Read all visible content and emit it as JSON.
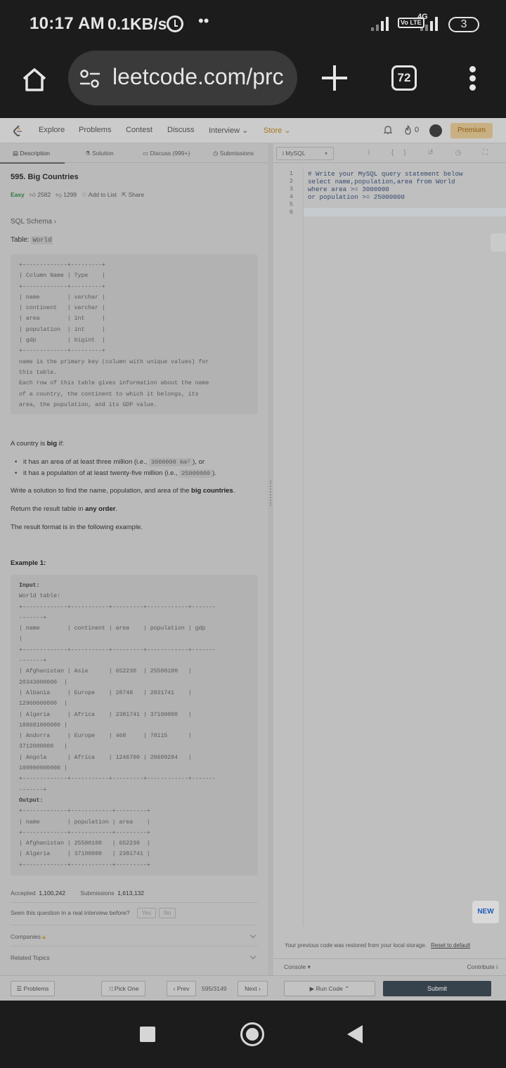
{
  "status": {
    "time": "10:17 AM",
    "speed": "0.1KB/s",
    "dots": "••",
    "volte": "Vo LTE",
    "network": "4G",
    "battery": "3"
  },
  "browser": {
    "url": "leetcode.com/prc",
    "tab_count": "72"
  },
  "nav": {
    "items": [
      "Explore",
      "Problems",
      "Contest",
      "Discuss",
      "Interview",
      "Store"
    ],
    "streak": "0",
    "premium": "Premium"
  },
  "tabs": [
    "Description",
    "Solution",
    "Discuss (999+)",
    "Submissions"
  ],
  "problem": {
    "title": "595. Big Countries",
    "difficulty": "Easy",
    "likes": "2582",
    "dislikes": "1299",
    "add_to_list": "Add to List",
    "share": "Share",
    "sql_schema": "SQL Schema",
    "table_label": "Table: ",
    "table_name": "World",
    "schema_pre": "+-------------+---------+\n| Column Name | Type    |\n+-------------+---------+\n| name        | varchar |\n| continent   | varchar |\n| area        | int     |\n| population  | int     |\n| gdp         | bigint  |\n+-------------+---------+\nname is the primary key (column with unique values) for\nthis table.\nEach row of this table gives information about the name\nof a country, the continent to which it belongs, its\narea, the population, and its GDP value.",
    "big_intro_pre": "A country is ",
    "big_word": "big",
    "big_intro_post": " if:",
    "bullet1_pre": "it has an area of at least three million (i.e., ",
    "bullet1_code": "3000000 km²",
    "bullet1_post": "), or",
    "bullet2_pre": "it has a population of at least twenty-five million (i.e., ",
    "bullet2_code": "25000000",
    "bullet2_post": ").",
    "write_pre": "Write a solution to find the name, population, and area of the ",
    "write_bold": "big countries",
    "write_post": ".",
    "return_pre": "Return the result table in ",
    "return_bold": "any order",
    "return_post": ".",
    "format_line": "The result format is in the following example.",
    "example_title": "Example 1:",
    "input_label": "Input:",
    "example_pre": "World table:\n+-------------+-----------+---------+------------+-------\n-------+\n| name        | continent | area    | population | gdp\n|\n+-------------+-----------+---------+------------+-------\n-------+\n| Afghanistan | Asia      | 652230  | 25500100   |\n20343000000  |\n| Albania     | Europe    | 28748   | 2831741    |\n12960000000  |\n| Algeria     | Africa    | 2381741 | 37100000   |\n188681000000 |\n| Andorra     | Europe    | 468     | 78115      |\n3712000000   |\n| Angola      | Africa    | 1246700 | 20609294   |\n100990000000 |\n+-------------+-----------+---------+------------+-------\n-------+",
    "output_label": "Output:",
    "output_pre": "+-------------+------------+---------+\n| name        | population | area    |\n+-------------+------------+---------+\n| Afghanistan | 25500100   | 652230  |\n| Algeria     | 37100000   | 2381741 |\n+-------------+------------+---------+"
  },
  "stats": {
    "accepted_label": "Accepted",
    "accepted": "1,100,242",
    "submissions_label": "Submissions",
    "submissions": "1,613,132",
    "seen_question": "Seen this question in a real interview before?",
    "yes": "Yes",
    "no": "No",
    "companies": "Companies",
    "related_topics": "Related Topics"
  },
  "editor": {
    "language": "MySQL",
    "icons": "i {} ↺ ◷ ⛶",
    "line_numbers": [
      "1",
      "2",
      "3",
      "4",
      "5",
      "6"
    ],
    "lines": [
      "# Write your MySQL query statement below",
      "select name,population,area from World",
      "where area >= 3000000",
      "or population >= 25000000",
      "",
      ""
    ],
    "new_badge": "NEW",
    "restore_msg": "Your previous code was restored from your local storage.",
    "reset_link": "Reset to default",
    "console": "Console",
    "contribute": "Contribute i"
  },
  "bottom": {
    "problems": "Problems",
    "pick_one": "Pick One",
    "prev": "Prev",
    "page": "595/3149",
    "next": "Next",
    "run_code": "Run Code",
    "submit": "Submit"
  }
}
